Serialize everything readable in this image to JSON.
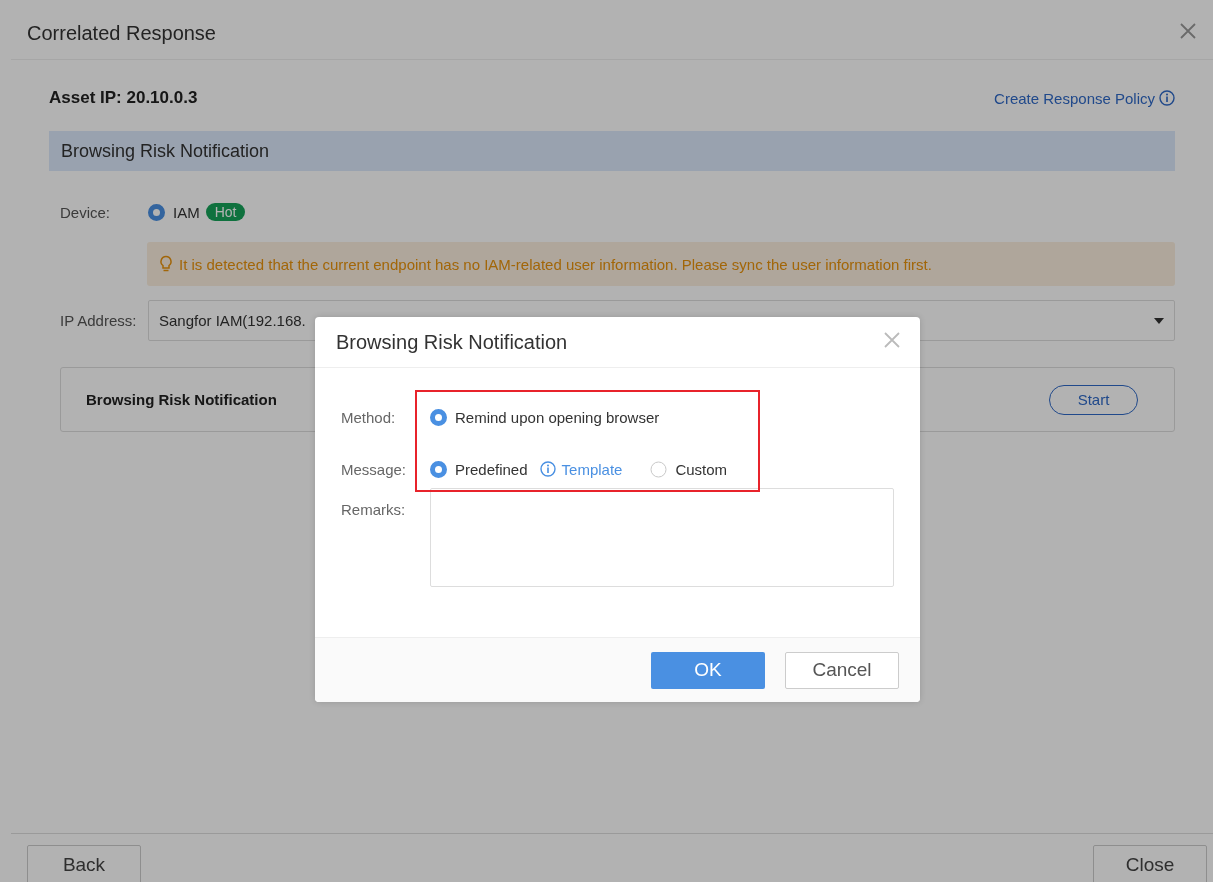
{
  "window": {
    "title": "Correlated Response"
  },
  "asset_ip": "Asset IP: 20.10.0.3",
  "create_policy_link": "Create Response Policy",
  "section_title": "Browsing Risk Notification",
  "device": {
    "label": "Device:",
    "options": [
      {
        "label": "IAM",
        "selected": true,
        "badge": "Hot"
      }
    ]
  },
  "warning": "It is detected that the current endpoint has no IAM-related user information. Please sync the user information first.",
  "ip_address": {
    "label": "IP Address:",
    "value": "Sangfor IAM(192.168."
  },
  "action_card": {
    "title": "Browsing Risk Notification",
    "button": "Start"
  },
  "footer_buttons": [
    "Back",
    "Close"
  ],
  "dialog": {
    "title": "Browsing Risk Notification",
    "method": {
      "label": "Method:",
      "options": [
        {
          "label": "Remind upon opening browser",
          "selected": true
        }
      ]
    },
    "message": {
      "label": "Message:",
      "options": [
        {
          "label": "Predefined",
          "selected": true,
          "link": "Template"
        },
        {
          "label": "Custom",
          "selected": false
        }
      ]
    },
    "remarks": {
      "label": "Remarks:"
    },
    "buttons": [
      {
        "label": "OK",
        "kind": "primary"
      },
      {
        "label": "Cancel",
        "kind": "default"
      }
    ]
  }
}
